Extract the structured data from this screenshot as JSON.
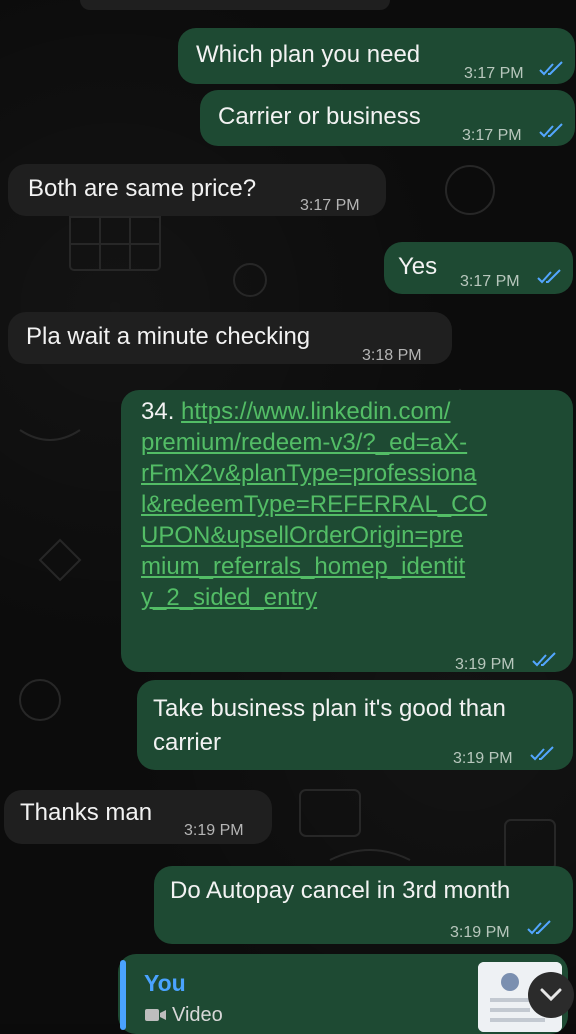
{
  "messages": [
    {
      "direction": "out",
      "text": "Which plan you need",
      "time": "3:17 PM"
    },
    {
      "direction": "out",
      "text": "Carrier or business",
      "time": "3:17 PM"
    },
    {
      "direction": "in",
      "text": "Both are same price?",
      "time": "3:17 PM"
    },
    {
      "direction": "out",
      "text": "Yes",
      "time": "3:17 PM"
    },
    {
      "direction": "in",
      "text": "Pla wait a minute checking",
      "time": "3:18 PM"
    },
    {
      "direction": "out",
      "prefix": "34. ",
      "link_lines": [
        "https://www.linkedin.com/",
        "premium/redeem-v3/?_ed=aX-",
        "rFmX2v&planType=professiona",
        "l&redeemType=REFERRAL_CO",
        "UPON&upsellOrderOrigin=pre",
        "mium_referrals_homep_identit",
        "y_2_sided_entry"
      ],
      "time": "3:19 PM"
    },
    {
      "direction": "out",
      "text": "Take business plan it's good than\ncarrier",
      "time": "3:19 PM"
    },
    {
      "direction": "in",
      "text": "Thanks man",
      "time": "3:19 PM"
    },
    {
      "direction": "out",
      "text": "Do Autopay cancel in 3rd month",
      "time": "3:19 PM"
    }
  ],
  "reply_preview": {
    "sender": "You",
    "type": "Video"
  },
  "icons": {
    "read_receipt": "double-check-icon",
    "video": "video-camera-icon",
    "scroll": "chevron-down-icon"
  },
  "colors": {
    "outgoing_bubble": "#1e4a33",
    "incoming_bubble": "#1f1f1f",
    "link": "#53bd66",
    "read_ticks": "#53a6ff",
    "reply_accent": "#4aa3ff"
  }
}
